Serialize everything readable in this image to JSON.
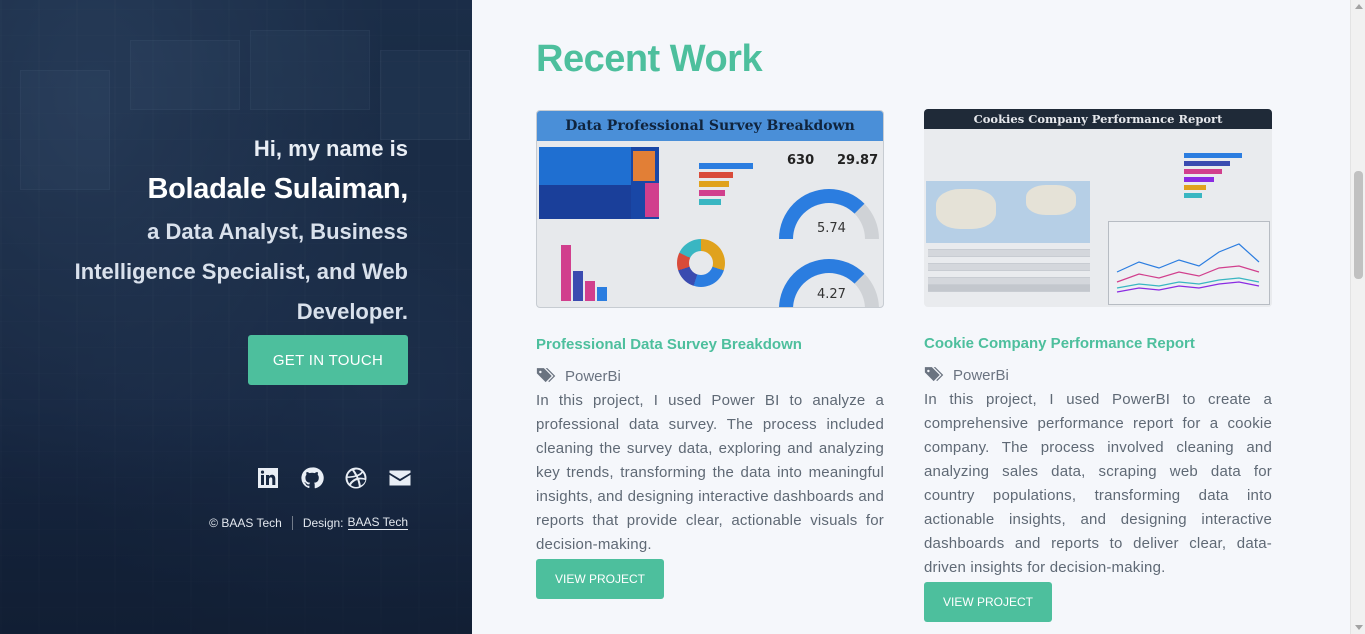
{
  "sidebar": {
    "greeting": "Hi, my name is",
    "name": "Boladale Sulaiman,",
    "role_line1": "a Data Analyst, Business",
    "role_line2": "Intelligence Specialist, and Web",
    "role_line3": "Developer.",
    "cta_label": "GET IN TOUCH",
    "socials": [
      "linkedin-icon",
      "github-icon",
      "dribbble-icon",
      "envelope-icon"
    ],
    "copyright": "© BAAS Tech",
    "design_prefix": "Design:",
    "design_link": "BAAS Tech"
  },
  "main": {
    "section_title": "Recent Work",
    "projects": [
      {
        "thumb_title": "Data Professional Survey Breakdown",
        "kpi1": "630",
        "kpi2": "29.87",
        "gauge1": "5.74",
        "gauge2": "4.27",
        "title": "Professional Data Survey Breakdown",
        "tag": "PowerBi",
        "description": "In this project, I used Power BI to analyze a professional data survey. The process included cleaning the survey data, exploring and analyzing key trends, transforming the data into meaningful insights, and designing interactive dashboards and reports that provide clear, actionable visuals for decision-making.",
        "button": "VIEW PROJECT"
      },
      {
        "thumb_title": "Cookies Company Performance Report",
        "title": "Cookie Company Performance Report",
        "tag": "PowerBi",
        "description": "In this project, I used PowerBI to create a comprehensive performance report for a cookie company. The process involved cleaning and analyzing sales data, scraping web data for country populations, transforming data into actionable insights, and designing interactive dashboards and reports to deliver clear, data-driven insights for decision-making.",
        "button": "VIEW PROJECT"
      }
    ]
  },
  "colors": {
    "accent": "#4dbf9d",
    "sidebar_bg": "#1a2c46",
    "main_bg": "#f5f7fb"
  }
}
